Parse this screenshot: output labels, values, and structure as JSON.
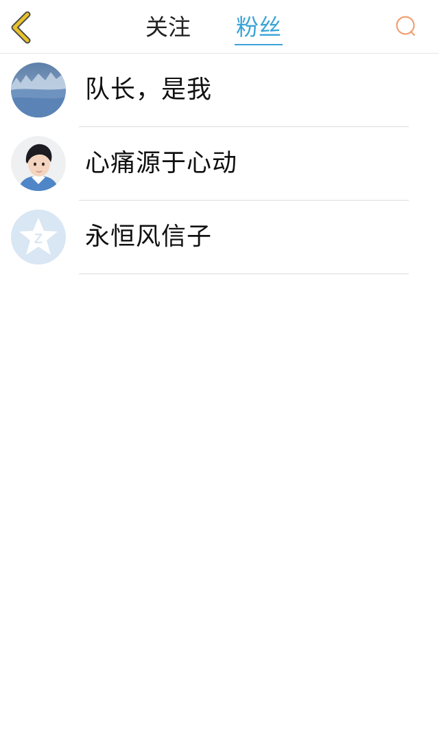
{
  "header": {
    "tabs": [
      {
        "label": "关注",
        "active": false
      },
      {
        "label": "粉丝",
        "active": true
      }
    ],
    "back_icon": "chevron-left-icon",
    "search_icon": "search-icon"
  },
  "colors": {
    "accent": "#3aa3d6",
    "back_icon": "#e8c22a",
    "search_icon": "#f0a070"
  },
  "fans": [
    {
      "name": "队长，是我",
      "avatar": "snow-landscape-photo"
    },
    {
      "name": "心痛源于心动",
      "avatar": "boy-portrait-photo"
    },
    {
      "name": "永恒风信子",
      "avatar": "default-qzone-star-avatar"
    }
  ]
}
